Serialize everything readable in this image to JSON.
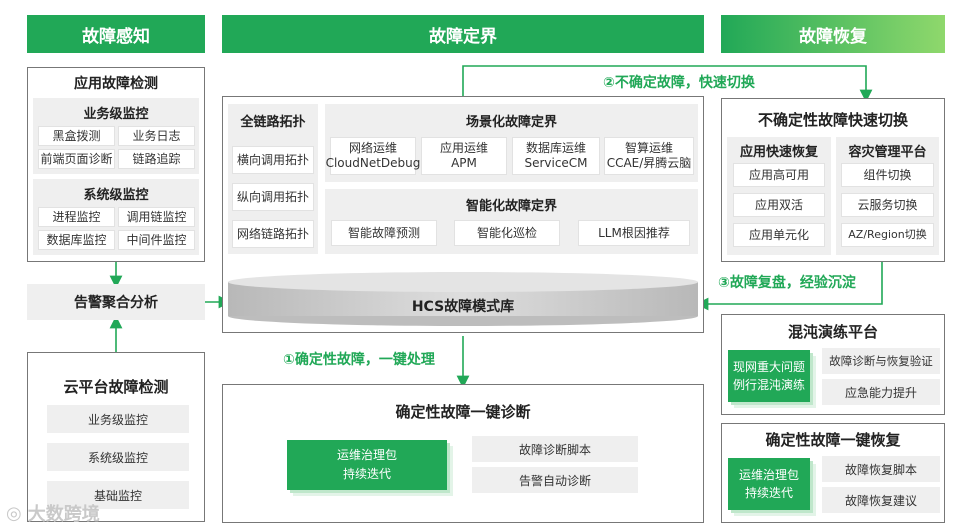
{
  "headers": {
    "perception": "故障感知",
    "demarcation": "故障定界",
    "recovery": "故障恢复"
  },
  "left": {
    "app_detect": {
      "title": "应用故障检测",
      "business": {
        "title": "业务级监控",
        "items": [
          "黑盒拨测",
          "业务日志",
          "前端页面诊断",
          "链路追踪"
        ]
      },
      "system": {
        "title": "系统级监控",
        "items": [
          "进程监控",
          "调用链监控",
          "数据库监控",
          "中间件监控"
        ]
      }
    },
    "alarm": "告警聚合分析",
    "cloud_detect": {
      "title": "云平台故障检测",
      "items": [
        "业务级监控",
        "系统级监控",
        "基础监控"
      ]
    }
  },
  "middle": {
    "topology": {
      "title": "全链路拓扑",
      "items": [
        "横向调用拓扑",
        "纵向调用拓扑",
        "网络链路拓扑"
      ]
    },
    "scene": {
      "title": "场景化故障定界",
      "items": [
        {
          "l1": "网络运维",
          "l2": "CloudNetDebug"
        },
        {
          "l1": "应用运维",
          "l2": "APM"
        },
        {
          "l1": "数据库运维",
          "l2": "ServiceCM"
        },
        {
          "l1": "智算运维",
          "l2": "CCAE/昇腾云脑"
        }
      ]
    },
    "intelligent": {
      "title": "智能化故障定界",
      "items": [
        "智能故障预测",
        "智能化巡检",
        "LLM根因推荐"
      ]
    },
    "library": "HCS故障模式库",
    "flow1": "①确定性故障，一键处理",
    "flow2": "②不确定故障，快速切换",
    "flow3": "③故障复盘，经验沉淀",
    "diagnose": {
      "title": "确定性故障一键诊断",
      "green_l1": "运维治理包",
      "green_l2": "持续迭代",
      "items": [
        "故障诊断脚本",
        "告警自动诊断"
      ]
    }
  },
  "right": {
    "switch": {
      "title": "不确定性故障快速切换",
      "app": {
        "title": "应用快速恢复",
        "items": [
          "应用高可用",
          "应用双活",
          "应用单元化"
        ]
      },
      "dr": {
        "title": "容灾管理平台",
        "items": [
          "组件切换",
          "云服务切换",
          "AZ/Region切换"
        ]
      }
    },
    "chaos": {
      "title": "混沌演练平台",
      "green_l1": "现网重大问题",
      "green_l2": "例行混沌演练",
      "items": [
        "故障诊断与恢复验证",
        "应急能力提升"
      ]
    },
    "recover": {
      "title": "确定性故障一键恢复",
      "green_l1": "运维治理包",
      "green_l2": "持续迭代",
      "items": [
        "故障恢复脚本",
        "故障恢复建议"
      ]
    }
  },
  "watermark": "大数跨境",
  "colors": {
    "brand_green": "#21a857",
    "light_green": "#8fd86c",
    "panel_grey": "#efefef"
  }
}
